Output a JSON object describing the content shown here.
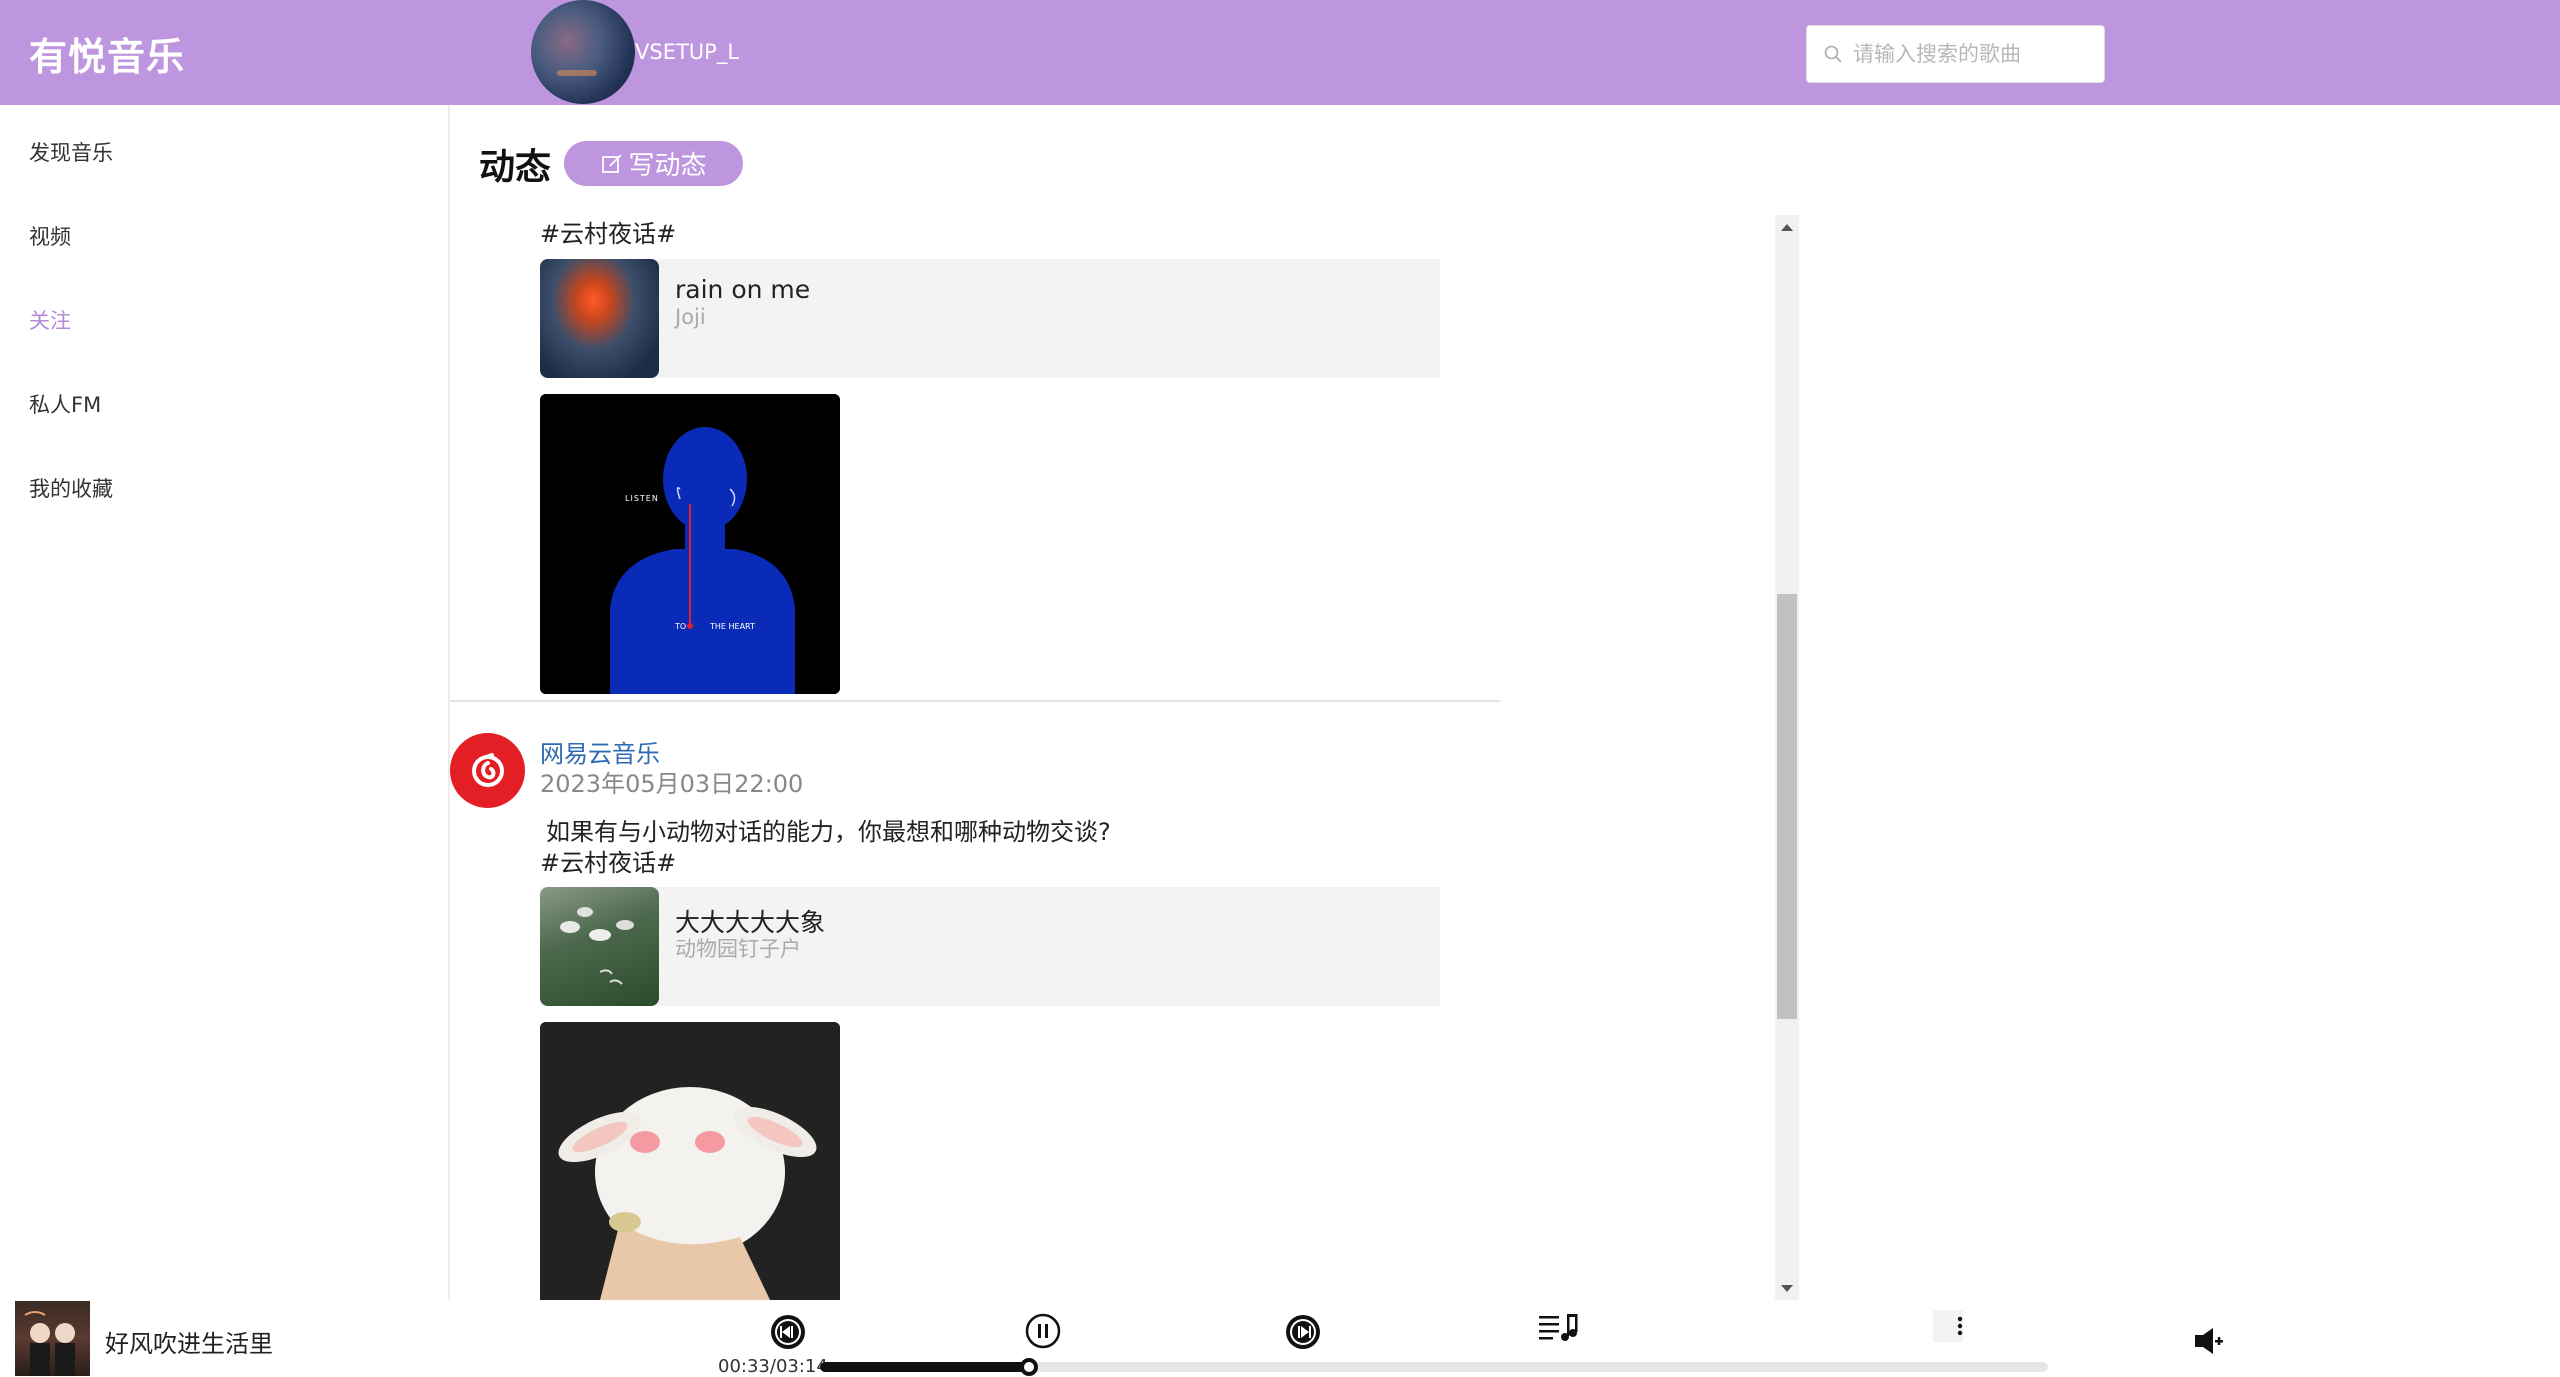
{
  "header": {
    "logo": "有悦音乐",
    "username": "VSETUP_L",
    "search_placeholder": "请输入搜索的歌曲"
  },
  "sidebar": {
    "items": [
      {
        "label": "发现音乐",
        "active": false
      },
      {
        "label": "视频",
        "active": false
      },
      {
        "label": "关注",
        "active": true
      },
      {
        "label": "私人FM",
        "active": false
      },
      {
        "label": "我的收藏",
        "active": false
      }
    ]
  },
  "main": {
    "title": "动态",
    "write_button": "写动态"
  },
  "posts": [
    {
      "tag": "#云村夜话#",
      "song": {
        "title": "rain on me",
        "artist": "Joji"
      },
      "image": {
        "words": [
          "LISTEN",
          "TO",
          "THE HEART"
        ]
      }
    },
    {
      "author": "网易云音乐",
      "time": "2023年05月03日22:00",
      "text": "如果有与小动物对话的能力，你最想和哪种动物交谈?",
      "tag": "#云村夜话#",
      "song": {
        "title": "大大大大大象",
        "artist": "动物园钉子户"
      }
    }
  ],
  "player": {
    "now_playing": "好风吹进生活里",
    "time": "00:33/03:14",
    "progress_fraction": 0.17
  },
  "icons": {
    "search": "search-icon",
    "write": "edit-icon",
    "prev": "previous-track-icon",
    "pause": "pause-icon",
    "next": "next-track-icon",
    "playlist": "playlist-icon",
    "more": "more-vertical-icon",
    "volume": "volume-icon"
  },
  "colors": {
    "accent": "#bd96df",
    "active_nav": "#b48ad8",
    "netease_red": "#e31f25",
    "author_link": "#2f6bb4"
  }
}
